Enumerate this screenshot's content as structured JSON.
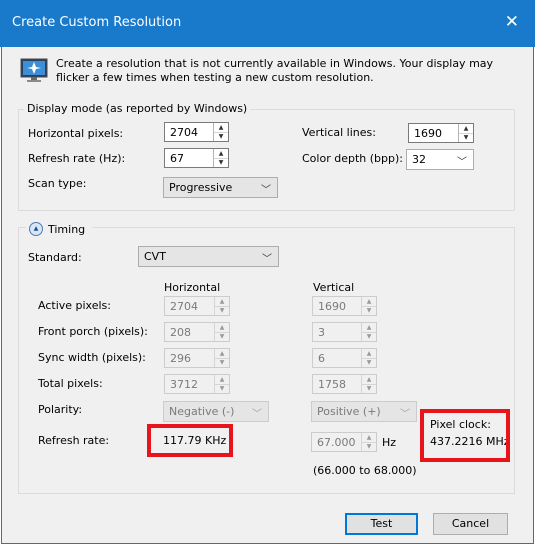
{
  "window": {
    "title": "Create Custom Resolution",
    "close_glyph": "✕"
  },
  "intro": "Create a resolution that is not currently available in Windows. Your display may flicker a few times when testing a new custom resolution.",
  "display_mode": {
    "group_title": "Display mode (as reported by Windows)",
    "horizontal_pixels_label": "Horizontal pixels:",
    "horizontal_pixels": "2704",
    "vertical_lines_label": "Vertical lines:",
    "vertical_lines": "1690",
    "refresh_rate_label": "Refresh rate (Hz):",
    "refresh_rate": "67",
    "color_depth_label": "Color depth (bpp):",
    "color_depth": "32",
    "scan_type_label": "Scan type:",
    "scan_type": "Progressive"
  },
  "timing": {
    "toggle_label": "Timing",
    "standard_label": "Standard:",
    "standard": "CVT",
    "col_horizontal": "Horizontal",
    "col_vertical": "Vertical",
    "active_pixels_label": "Active pixels:",
    "front_porch_label": "Front porch (pixels):",
    "sync_width_label": "Sync width (pixels):",
    "total_pixels_label": "Total pixels:",
    "polarity_label": "Polarity:",
    "refresh_rate_label": "Refresh rate:",
    "h_active": "2704",
    "h_front_porch": "208",
    "h_sync_width": "296",
    "h_total": "3712",
    "h_polarity": "Negative (-)",
    "h_refresh": "117.79 KHz",
    "v_active": "1690",
    "v_front_porch": "3",
    "v_sync_width": "6",
    "v_total": "1758",
    "v_polarity": "Positive (+)",
    "v_refresh": "67.000",
    "v_refresh_unit": "Hz",
    "v_refresh_range": "(66.000 to 68.000)",
    "pixel_clock_label": "Pixel clock:",
    "pixel_clock": "437.2216 MHz"
  },
  "buttons": {
    "test": "Test",
    "cancel": "Cancel"
  },
  "colors": {
    "titlebar": "#1979ca",
    "highlight": "#e8141c",
    "default_button_border": "#0078d7"
  }
}
